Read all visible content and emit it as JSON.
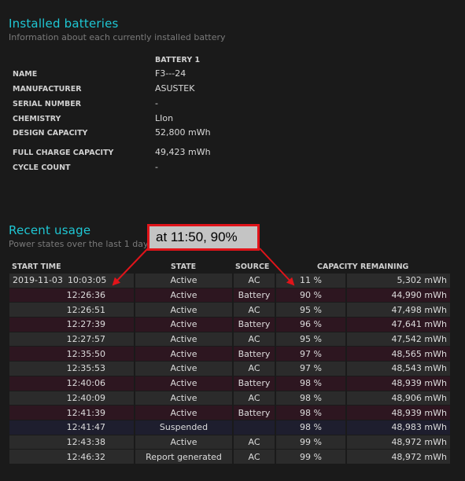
{
  "installed": {
    "title": "Installed batteries",
    "subtitle": "Information about each currently installed battery",
    "battery_header": "BATTERY 1",
    "rows": [
      {
        "label": "NAME",
        "value": "F3---24"
      },
      {
        "label": "MANUFACTURER",
        "value": "ASUSTEK"
      },
      {
        "label": "SERIAL NUMBER",
        "value": "-"
      },
      {
        "label": "CHEMISTRY",
        "value": "LIon"
      },
      {
        "label": "DESIGN CAPACITY",
        "value": "52,800 mWh"
      },
      {
        "label": "FULL CHARGE CAPACITY",
        "value": "49,423 mWh"
      },
      {
        "label": "CYCLE COUNT",
        "value": "-"
      }
    ]
  },
  "recent": {
    "title": "Recent usage",
    "subtitle": "Power states over the last 1 days",
    "headers": {
      "start_time": "START TIME",
      "state": "STATE",
      "source": "SOURCE",
      "capacity": "CAPACITY REMAINING"
    },
    "rows": [
      {
        "date": "2019-11-03",
        "time": "10:03:05",
        "state": "Active",
        "source": "AC",
        "pct": "11 %",
        "mwh": "5,302 mWh",
        "kind": "ac"
      },
      {
        "date": "",
        "time": "12:26:36",
        "state": "Active",
        "source": "Battery",
        "pct": "90 %",
        "mwh": "44,990 mWh",
        "kind": "battery"
      },
      {
        "date": "",
        "time": "12:26:51",
        "state": "Active",
        "source": "AC",
        "pct": "95 %",
        "mwh": "47,498 mWh",
        "kind": "ac"
      },
      {
        "date": "",
        "time": "12:27:39",
        "state": "Active",
        "source": "Battery",
        "pct": "96 %",
        "mwh": "47,641 mWh",
        "kind": "battery"
      },
      {
        "date": "",
        "time": "12:27:57",
        "state": "Active",
        "source": "AC",
        "pct": "95 %",
        "mwh": "47,542 mWh",
        "kind": "ac"
      },
      {
        "date": "",
        "time": "12:35:50",
        "state": "Active",
        "source": "Battery",
        "pct": "97 %",
        "mwh": "48,565 mWh",
        "kind": "battery"
      },
      {
        "date": "",
        "time": "12:35:53",
        "state": "Active",
        "source": "AC",
        "pct": "97 %",
        "mwh": "48,543 mWh",
        "kind": "ac"
      },
      {
        "date": "",
        "time": "12:40:06",
        "state": "Active",
        "source": "Battery",
        "pct": "98 %",
        "mwh": "48,939 mWh",
        "kind": "battery"
      },
      {
        "date": "",
        "time": "12:40:09",
        "state": "Active",
        "source": "AC",
        "pct": "98 %",
        "mwh": "48,906 mWh",
        "kind": "ac"
      },
      {
        "date": "",
        "time": "12:41:39",
        "state": "Active",
        "source": "Battery",
        "pct": "98 %",
        "mwh": "48,939 mWh",
        "kind": "battery"
      },
      {
        "date": "",
        "time": "12:41:47",
        "state": "Suspended",
        "source": "",
        "pct": "98 %",
        "mwh": "48,983 mWh",
        "kind": "suspended"
      },
      {
        "date": "",
        "time": "12:43:38",
        "state": "Active",
        "source": "AC",
        "pct": "99 %",
        "mwh": "48,972 mWh",
        "kind": "ac"
      },
      {
        "date": "",
        "time": "12:46:32",
        "state": "Report generated",
        "source": "AC",
        "pct": "99 %",
        "mwh": "48,972 mWh",
        "kind": "ac"
      }
    ]
  },
  "annotation": {
    "text": "at 11:50,  90%",
    "color": "#e0141a"
  },
  "colors": {
    "heading": "#1fc7d4",
    "row_ac": "#2b2b2b",
    "row_battery": "#2d1620",
    "row_suspended": "#1e1e2e"
  }
}
